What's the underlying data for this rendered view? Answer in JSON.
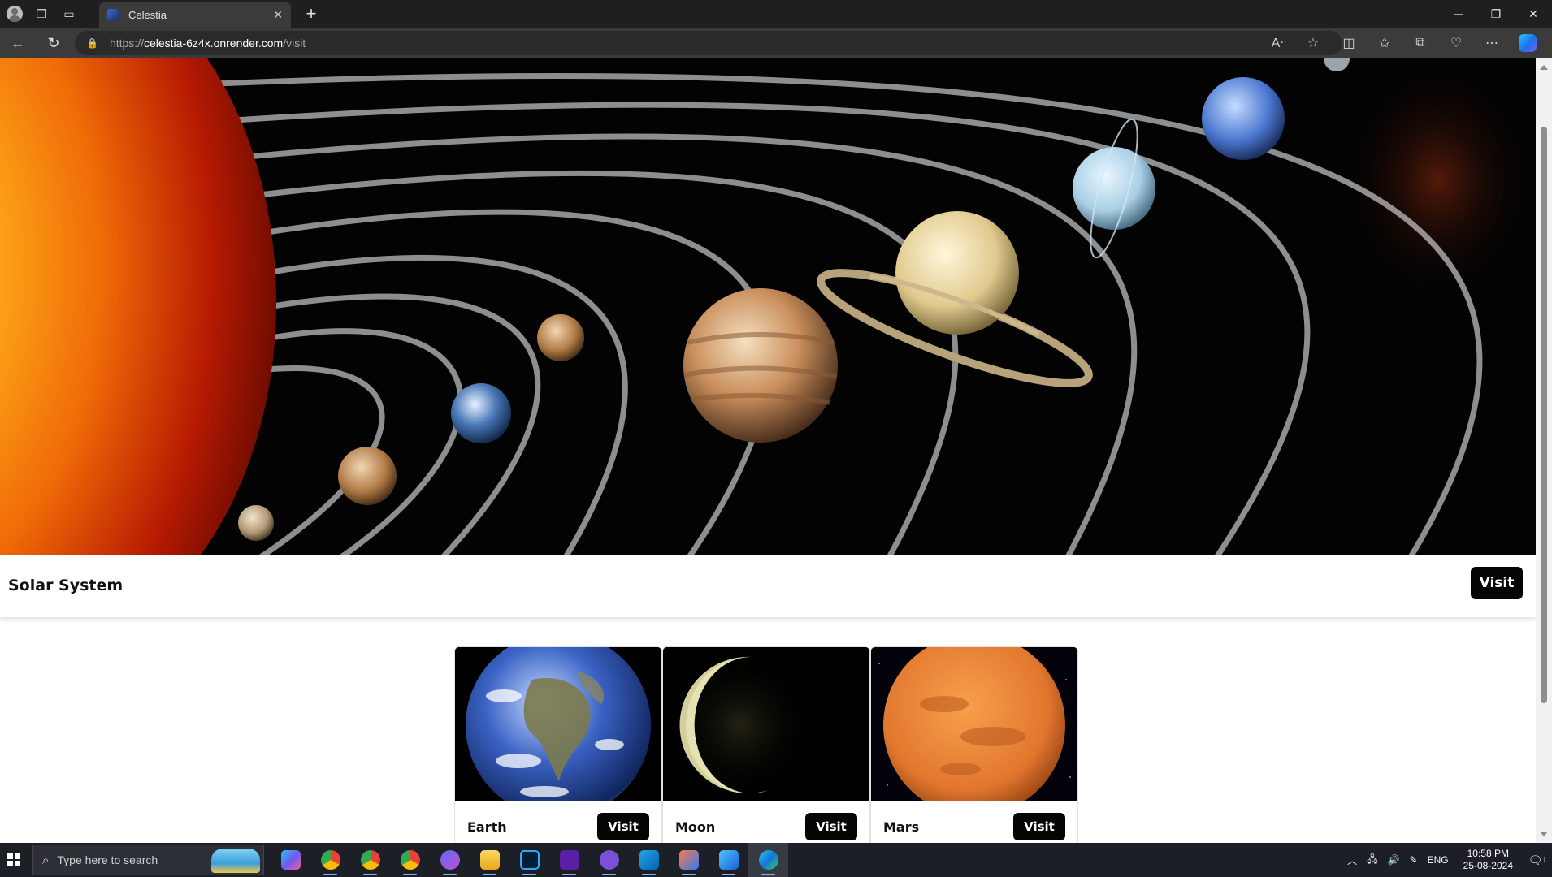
{
  "browser": {
    "tab_title": "Celestia",
    "url_scheme": "https://",
    "url_host": "celestia-6z4x.onrender.com",
    "url_path": "/visit"
  },
  "hero_card": {
    "title": "Solar System",
    "visit_label": "Visit"
  },
  "planets": [
    {
      "name": "Earth",
      "visit_label": "Visit"
    },
    {
      "name": "Moon",
      "visit_label": "Visit"
    },
    {
      "name": "Mars",
      "visit_label": "Visit"
    }
  ],
  "taskbar": {
    "search_placeholder": "Type here to search",
    "language": "ENG",
    "time": "10:58 PM",
    "date": "25-08-2024",
    "notification_count": "1"
  },
  "colors": {
    "accent_button": "#050505",
    "chrome_dark": "#1f1f1f"
  }
}
